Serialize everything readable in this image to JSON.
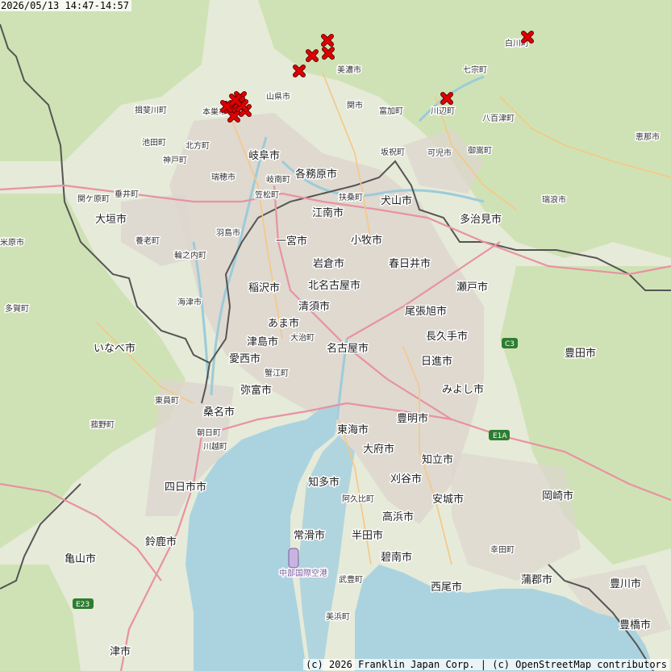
{
  "timestamp": "2026/05/13 14:47-14:57",
  "attribution": "(c) 2026 Franklin Japan Corp. | (c) OpenStreetMap contributors",
  "colors": {
    "land": "#e6ead8",
    "forest": "#c9dfb0",
    "urban": "#dcd4cc",
    "water": "#aad3df",
    "boundary": "#555555",
    "lightning_marker": "#e00000"
  },
  "map": {
    "labels_large": [
      "岐阜市",
      "各務原市",
      "大垣市",
      "羽島市",
      "一宮市",
      "江南市",
      "犬山市",
      "小牧市",
      "岩倉市",
      "春日井市",
      "多治見市",
      "稲沢市",
      "北名古屋市",
      "清須市",
      "瀬戸市",
      "尾張旭市",
      "あま市",
      "津島市",
      "名古屋市",
      "長久手市",
      "愛西市",
      "日進市",
      "いなべ市",
      "豊田市",
      "みよし市",
      "弥富市",
      "桑名市",
      "東海市",
      "豊明市",
      "大府市",
      "知立市",
      "四日市市",
      "知多市",
      "刈谷市",
      "安城市",
      "岡崎市",
      "常滑市",
      "半田市",
      "高浜市",
      "碧南市",
      "鈴鹿市",
      "亀山市",
      "西尾市",
      "蒲郡市",
      "豊川市",
      "豊橋市",
      "津市"
    ],
    "labels_small": [
      "揖斐川町",
      "本巣市",
      "山県市",
      "関市",
      "美濃市",
      "富加町",
      "川辺町",
      "八百津町",
      "白川町",
      "七宗町",
      "池田町",
      "北方町",
      "神戸町",
      "瑞穂市",
      "岐南町",
      "笠松町",
      "坂祝町",
      "可児市",
      "御嵩町",
      "恵那市",
      "扶桑町",
      "関ケ原町",
      "垂井町",
      "養老町",
      "輪之内町",
      "海津市",
      "多賀町",
      "大治町",
      "蟹江町",
      "東員町",
      "菰野町",
      "朝日町",
      "川越町",
      "阿久比町",
      "武豊町",
      "美浜町",
      "中部国際空港",
      "幸田町",
      "瑞浪市",
      "米原市"
    ],
    "road_shields": [
      "E1A",
      "C3",
      "E23"
    ]
  },
  "lightning_strikes": {
    "count": 14,
    "symbol": "red-x-icon"
  }
}
